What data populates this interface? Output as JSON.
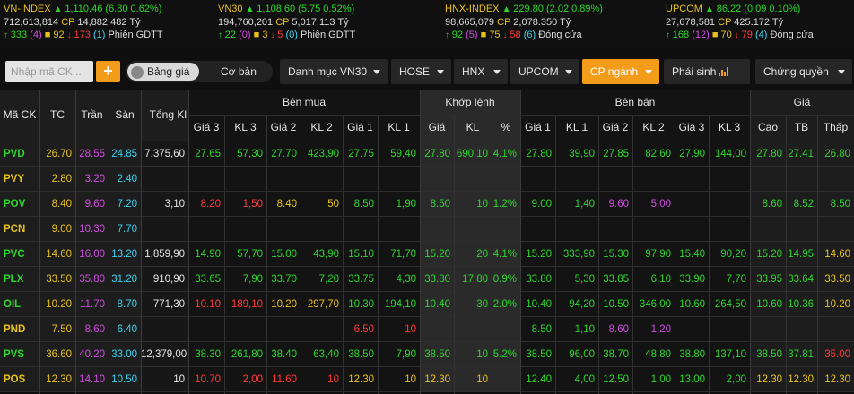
{
  "indices": [
    {
      "name": "VN-INDEX",
      "value": "1,110.46",
      "change": "(6.80 0.62%)",
      "volume": "712,613,814",
      "cp_label": "CP",
      "cp_value": "14,882.482",
      "unit": "Tỷ",
      "up": "333",
      "ref": "(4)",
      "flat": "92",
      "down": "173",
      "floor": "(1)",
      "status": "Phiên GDTT"
    },
    {
      "name": "VN30",
      "value": "1,108.60",
      "change": "(5.75 0.52%)",
      "volume": "194,760,201",
      "cp_label": "CP",
      "cp_value": "5,017.113",
      "unit": "Tỷ",
      "up": "22",
      "ref": "(0)",
      "flat": "3",
      "down": "5",
      "floor": "(0)",
      "status": "Phiên GDTT"
    },
    {
      "name": "HNX-INDEX",
      "value": "229.80",
      "change": "(2.02 0.89%)",
      "volume": "98,665,079",
      "cp_label": "CP",
      "cp_value": "2,078.350",
      "unit": "Tỷ",
      "up": "92",
      "ref": "(5)",
      "flat": "75",
      "down": "58",
      "floor": "(6)",
      "status": "Đóng cửa"
    },
    {
      "name": "UPCOM",
      "value": "86.22",
      "change": "(0.09 0.10%)",
      "volume": "27,678,581",
      "cp_label": "CP",
      "cp_value": "425.172",
      "unit": "Tỷ",
      "up": "168",
      "ref": "(12)",
      "flat": "70",
      "down": "79",
      "floor": "(4)",
      "status": "Đóng cửa"
    }
  ],
  "toolbar": {
    "search_placeholder": "Nhập mã CK...",
    "add_label": "+",
    "toggle_on": "Bảng giá",
    "toggle_off": "Cơ bản",
    "menus": [
      "Danh mục VN30",
      "HOSE",
      "HNX",
      "UPCOM",
      "CP ngành",
      "Phái sinh",
      "Chứng quyền"
    ],
    "active_menu": "CP ngành"
  },
  "colors": {
    "accent": "#f39c1a",
    "up": "#2fd62f",
    "down": "#ff3b3b",
    "ref": "#e8c21d",
    "ceiling": "#d04ee0",
    "floor": "#3fd2f0"
  },
  "table": {
    "group_headers": {
      "buy": "Bên mua",
      "match": "Khớp lệnh",
      "sell": "Bên bán",
      "price": "Giá"
    },
    "headers": {
      "sym": "Mã CK",
      "tc": "TC",
      "tran": "Trần",
      "san": "Sàn",
      "tong": "Tổng Kl",
      "b3": "Giá 3",
      "bk3": "KL 3",
      "b2": "Giá 2",
      "bk2": "KL 2",
      "b1": "Giá 1",
      "bk1": "KL 1",
      "mp": "Giá",
      "mk": "KL",
      "mpct": "%",
      "s1": "Giá 1",
      "sk1": "KL 1",
      "s2": "Giá 2",
      "sk2": "KL 2",
      "s3": "Giá 3",
      "sk3": "KL 3",
      "cao": "Cao",
      "tb": "TB",
      "thap": "Thấp"
    },
    "rows": [
      {
        "sym": "PVD",
        "tc": "26.70",
        "tran": "28.55",
        "san": "24.85",
        "tong": "7,375,60",
        "b3": "27.65",
        "bk3": "57,30",
        "b2": "27.70",
        "bk2": "423,90",
        "b1": "27.75",
        "bk1": "59,40",
        "mp": "27.80",
        "mk": "690,10",
        "mpct": "4.1%",
        "s1": "27.80",
        "sk1": "39,90",
        "s2": "27.85",
        "sk2": "82,60",
        "s3": "27.90",
        "sk3": "144,00",
        "cao": "27.80",
        "tb": "27.41",
        "thap": "26.80"
      },
      {
        "sym": "PVY",
        "tc": "2.80",
        "tran": "3.20",
        "san": "2.40",
        "tong": "",
        "b3": "",
        "bk3": "",
        "b2": "",
        "bk2": "",
        "b1": "",
        "bk1": "",
        "mp": "",
        "mk": "",
        "mpct": "",
        "s1": "",
        "sk1": "",
        "s2": "",
        "sk2": "",
        "s3": "",
        "sk3": "",
        "cao": "",
        "tb": "",
        "thap": ""
      },
      {
        "sym": "POV",
        "tc": "8.40",
        "tran": "9.60",
        "san": "7.20",
        "tong": "3,10",
        "b3": "8.20",
        "bk3": "1,50",
        "b2": "8.40",
        "bk2": "50",
        "b1": "8.50",
        "bk1": "1,90",
        "mp": "8.50",
        "mk": "10",
        "mpct": "1.2%",
        "s1": "9.00",
        "sk1": "1,40",
        "s2": "9.60",
        "sk2": "5,00",
        "s3": "",
        "sk3": "",
        "cao": "8.60",
        "tb": "8.52",
        "thap": "8.50"
      },
      {
        "sym": "PCN",
        "tc": "9.00",
        "tran": "10.30",
        "san": "7.70",
        "tong": "",
        "b3": "",
        "bk3": "",
        "b2": "",
        "bk2": "",
        "b1": "",
        "bk1": "",
        "mp": "",
        "mk": "",
        "mpct": "",
        "s1": "",
        "sk1": "",
        "s2": "",
        "sk2": "",
        "s3": "",
        "sk3": "",
        "cao": "",
        "tb": "",
        "thap": ""
      },
      {
        "sym": "PVC",
        "tc": "14.60",
        "tran": "16.00",
        "san": "13.20",
        "tong": "1,859,90",
        "b3": "14.90",
        "bk3": "57,70",
        "b2": "15.00",
        "bk2": "43,90",
        "b1": "15.10",
        "bk1": "71,70",
        "mp": "15.20",
        "mk": "20",
        "mpct": "4.1%",
        "s1": "15.20",
        "sk1": "333,90",
        "s2": "15.30",
        "sk2": "97,90",
        "s3": "15.40",
        "sk3": "90,20",
        "cao": "15.20",
        "tb": "14.95",
        "thap": "14.60"
      },
      {
        "sym": "PLX",
        "tc": "33.50",
        "tran": "35.80",
        "san": "31.20",
        "tong": "910,90",
        "b3": "33.65",
        "bk3": "7,90",
        "b2": "33.70",
        "bk2": "7,20",
        "b1": "33.75",
        "bk1": "4,30",
        "mp": "33.80",
        "mk": "17,80",
        "mpct": "0.9%",
        "s1": "33.80",
        "sk1": "5,30",
        "s2": "33.85",
        "sk2": "6,10",
        "s3": "33.90",
        "sk3": "7,70",
        "cao": "33.95",
        "tb": "33.64",
        "thap": "33.50"
      },
      {
        "sym": "OIL",
        "tc": "10.20",
        "tran": "11.70",
        "san": "8.70",
        "tong": "771,30",
        "b3": "10.10",
        "bk3": "189,10",
        "b2": "10.20",
        "bk2": "297,70",
        "b1": "10.30",
        "bk1": "194,10",
        "mp": "10.40",
        "mk": "30",
        "mpct": "2.0%",
        "s1": "10.40",
        "sk1": "94,20",
        "s2": "10.50",
        "sk2": "346,00",
        "s3": "10.60",
        "sk3": "264,50",
        "cao": "10.60",
        "tb": "10.36",
        "thap": "10.20"
      },
      {
        "sym": "PND",
        "tc": "7.50",
        "tran": "8.60",
        "san": "6.40",
        "tong": "",
        "b3": "",
        "bk3": "",
        "b2": "",
        "bk2": "",
        "b1": "6.50",
        "bk1": "10",
        "mp": "",
        "mk": "",
        "mpct": "",
        "s1": "8.50",
        "sk1": "1,10",
        "s2": "8.60",
        "sk2": "1,20",
        "s3": "",
        "sk3": "",
        "cao": "",
        "tb": "",
        "thap": ""
      },
      {
        "sym": "PVS",
        "tc": "36.60",
        "tran": "40.20",
        "san": "33.00",
        "tong": "12,379,00",
        "b3": "38.30",
        "bk3": "261,80",
        "b2": "38.40",
        "bk2": "63,40",
        "b1": "38.50",
        "bk1": "7,90",
        "mp": "38.50",
        "mk": "10",
        "mpct": "5.2%",
        "s1": "38.50",
        "sk1": "96,00",
        "s2": "38.70",
        "sk2": "48,80",
        "s3": "38.80",
        "sk3": "137,10",
        "cao": "38.50",
        "tb": "37.81",
        "thap": "35.00"
      },
      {
        "sym": "POS",
        "tc": "12.30",
        "tran": "14.10",
        "san": "10.50",
        "tong": "10",
        "b3": "10.70",
        "bk3": "2,00",
        "b2": "11.60",
        "bk2": "10",
        "b1": "12.30",
        "bk1": "10",
        "mp": "12.30",
        "mk": "10",
        "mpct": "",
        "s1": "12.40",
        "sk1": "4,00",
        "s2": "12.50",
        "sk2": "1,00",
        "s3": "13.00",
        "sk3": "2,00",
        "cao": "12.30",
        "tb": "12.30",
        "thap": "12.30"
      }
    ]
  }
}
